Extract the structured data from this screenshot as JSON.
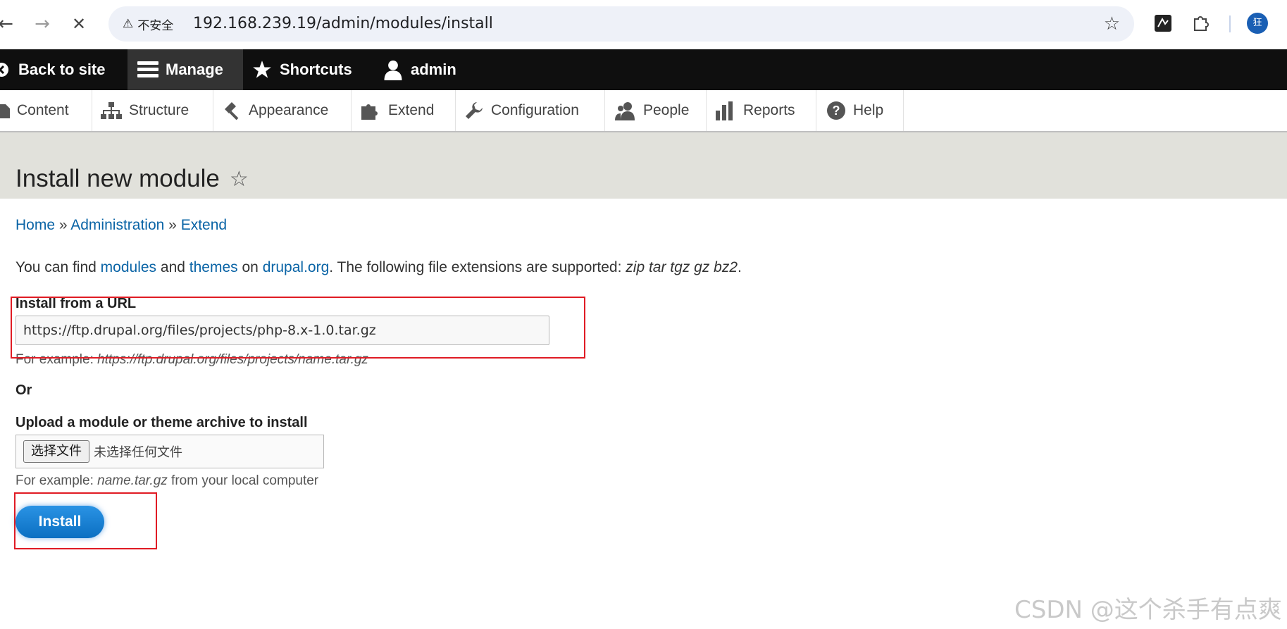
{
  "browser": {
    "security_label": "不安全",
    "url": "192.168.239.19/admin/modules/install",
    "profile_initial": "狂"
  },
  "toolbar": {
    "items": [
      {
        "label": "Back to site",
        "icon": "back-arrow-circle-icon"
      },
      {
        "label": "Manage",
        "icon": "hamburger-menu-icon",
        "active": true
      },
      {
        "label": "Shortcuts",
        "icon": "star-icon"
      },
      {
        "label": "admin",
        "icon": "user-icon"
      }
    ]
  },
  "tray": {
    "items": [
      {
        "label": "Content",
        "icon": "file-icon"
      },
      {
        "label": "Structure",
        "icon": "sitemap-icon"
      },
      {
        "label": "Appearance",
        "icon": "paintbrush-icon"
      },
      {
        "label": "Extend",
        "icon": "puzzle-icon"
      },
      {
        "label": "Configuration",
        "icon": "wrench-icon"
      },
      {
        "label": "People",
        "icon": "people-icon"
      },
      {
        "label": "Reports",
        "icon": "bar-chart-icon"
      },
      {
        "label": "Help",
        "icon": "question-circle-icon"
      }
    ]
  },
  "page": {
    "title": "Install new module"
  },
  "breadcrumb": {
    "home": "Home",
    "sep": "»",
    "administration": "Administration",
    "extend": "Extend"
  },
  "intro": {
    "text1": "You can find ",
    "modules": "modules",
    "text2": " and ",
    "themes": "themes",
    "text3": " on ",
    "drupal": "drupal.org",
    "text4": ". The following file extensions are supported: ",
    "extensions": "zip tar tgz gz bz2",
    "text5": "."
  },
  "form": {
    "url_label": "Install from a URL",
    "url_value": "https://ftp.drupal.org/files/projects/php-8.x-1.0.tar.gz",
    "url_example_prefix": "For example: ",
    "url_example": "https://ftp.drupal.org/files/projects/name.tar.gz",
    "or_label": "Or",
    "upload_label": "Upload a module or theme archive to install",
    "file_button": "选择文件",
    "file_status": "未选择任何文件",
    "upload_example_prefix": "For example: ",
    "upload_example": "name.tar.gz",
    "upload_example_suffix": " from your local computer",
    "install_button": "Install"
  },
  "watermark": "CSDN @这个杀手有点爽",
  "colors": {
    "annotation_red": "#e01b24",
    "link_blue": "#0a64a6",
    "toolbar_black": "#0f0f0f",
    "install_blue": "#1a80d4"
  }
}
